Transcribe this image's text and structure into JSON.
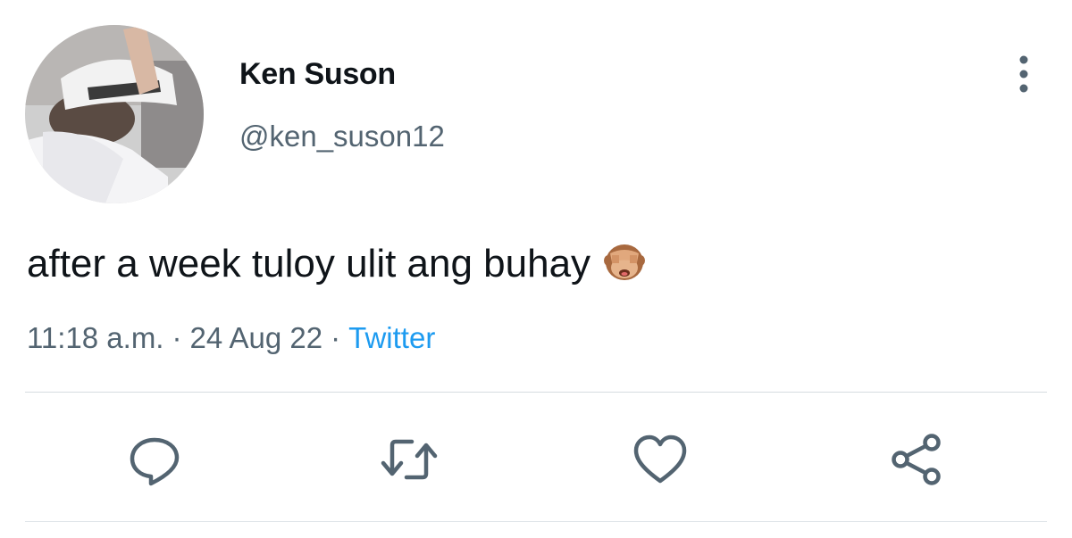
{
  "user": {
    "display_name": "Ken Suson",
    "handle": "@ken_suson12",
    "avatar_icon": "profile-photo-avatar"
  },
  "tweet": {
    "text": "after a week tuloy ulit ang buhay",
    "emoji": "🙈"
  },
  "meta": {
    "time": "11:18 a.m.",
    "separator": "·",
    "date": "24 Aug 22",
    "source": "Twitter"
  },
  "actions": [
    {
      "name": "reply",
      "icon": "reply-bubble-icon"
    },
    {
      "name": "retweet",
      "icon": "retweet-icon"
    },
    {
      "name": "like",
      "icon": "heart-icon"
    },
    {
      "name": "share",
      "icon": "share-icon"
    }
  ],
  "colors": {
    "text": "#0f1419",
    "secondary": "#536471",
    "link": "#1d9bf0",
    "icon": "#536471"
  }
}
